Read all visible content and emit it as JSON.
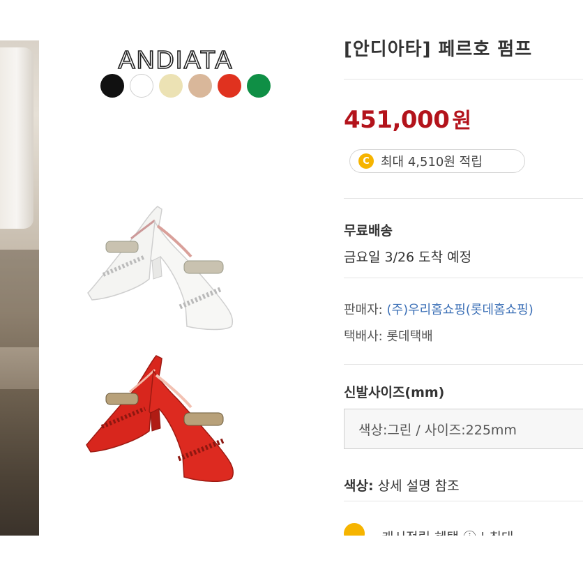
{
  "brand": {
    "logo_text": "ANDIATA",
    "swatch_colors": [
      "#111111",
      "#ffffff",
      "#ece2b4",
      "#d9b79a",
      "#e0321f",
      "#0f8f45"
    ]
  },
  "product": {
    "title": "[안디아타] 페르호 펌프",
    "price_value": "451,000",
    "price_unit": "원",
    "points": {
      "coin_symbol": "C",
      "text": "최대 4,510원 적립"
    }
  },
  "shipping": {
    "label": "무료배송",
    "arrival": "금요일 3/26 도착 예정"
  },
  "seller": {
    "seller_label": "판매자:",
    "seller_name": "(주)우리홈쇼핑(롯데홈쇼핑)",
    "courier_label": "택배사:",
    "courier_name": "롯데택배"
  },
  "size": {
    "label": "신발사이즈(mm)",
    "selected": "색상:그린 / 사이즈:225mm"
  },
  "color": {
    "label": "색상:",
    "value": "상세 설명 참조"
  },
  "benefit": {
    "text": "캐시적립 혜택 ⓘ | 최대"
  },
  "colors": {
    "price_red": "#b3131b",
    "link_blue": "#3b6fb6",
    "coin_gold": "#f6b400"
  }
}
